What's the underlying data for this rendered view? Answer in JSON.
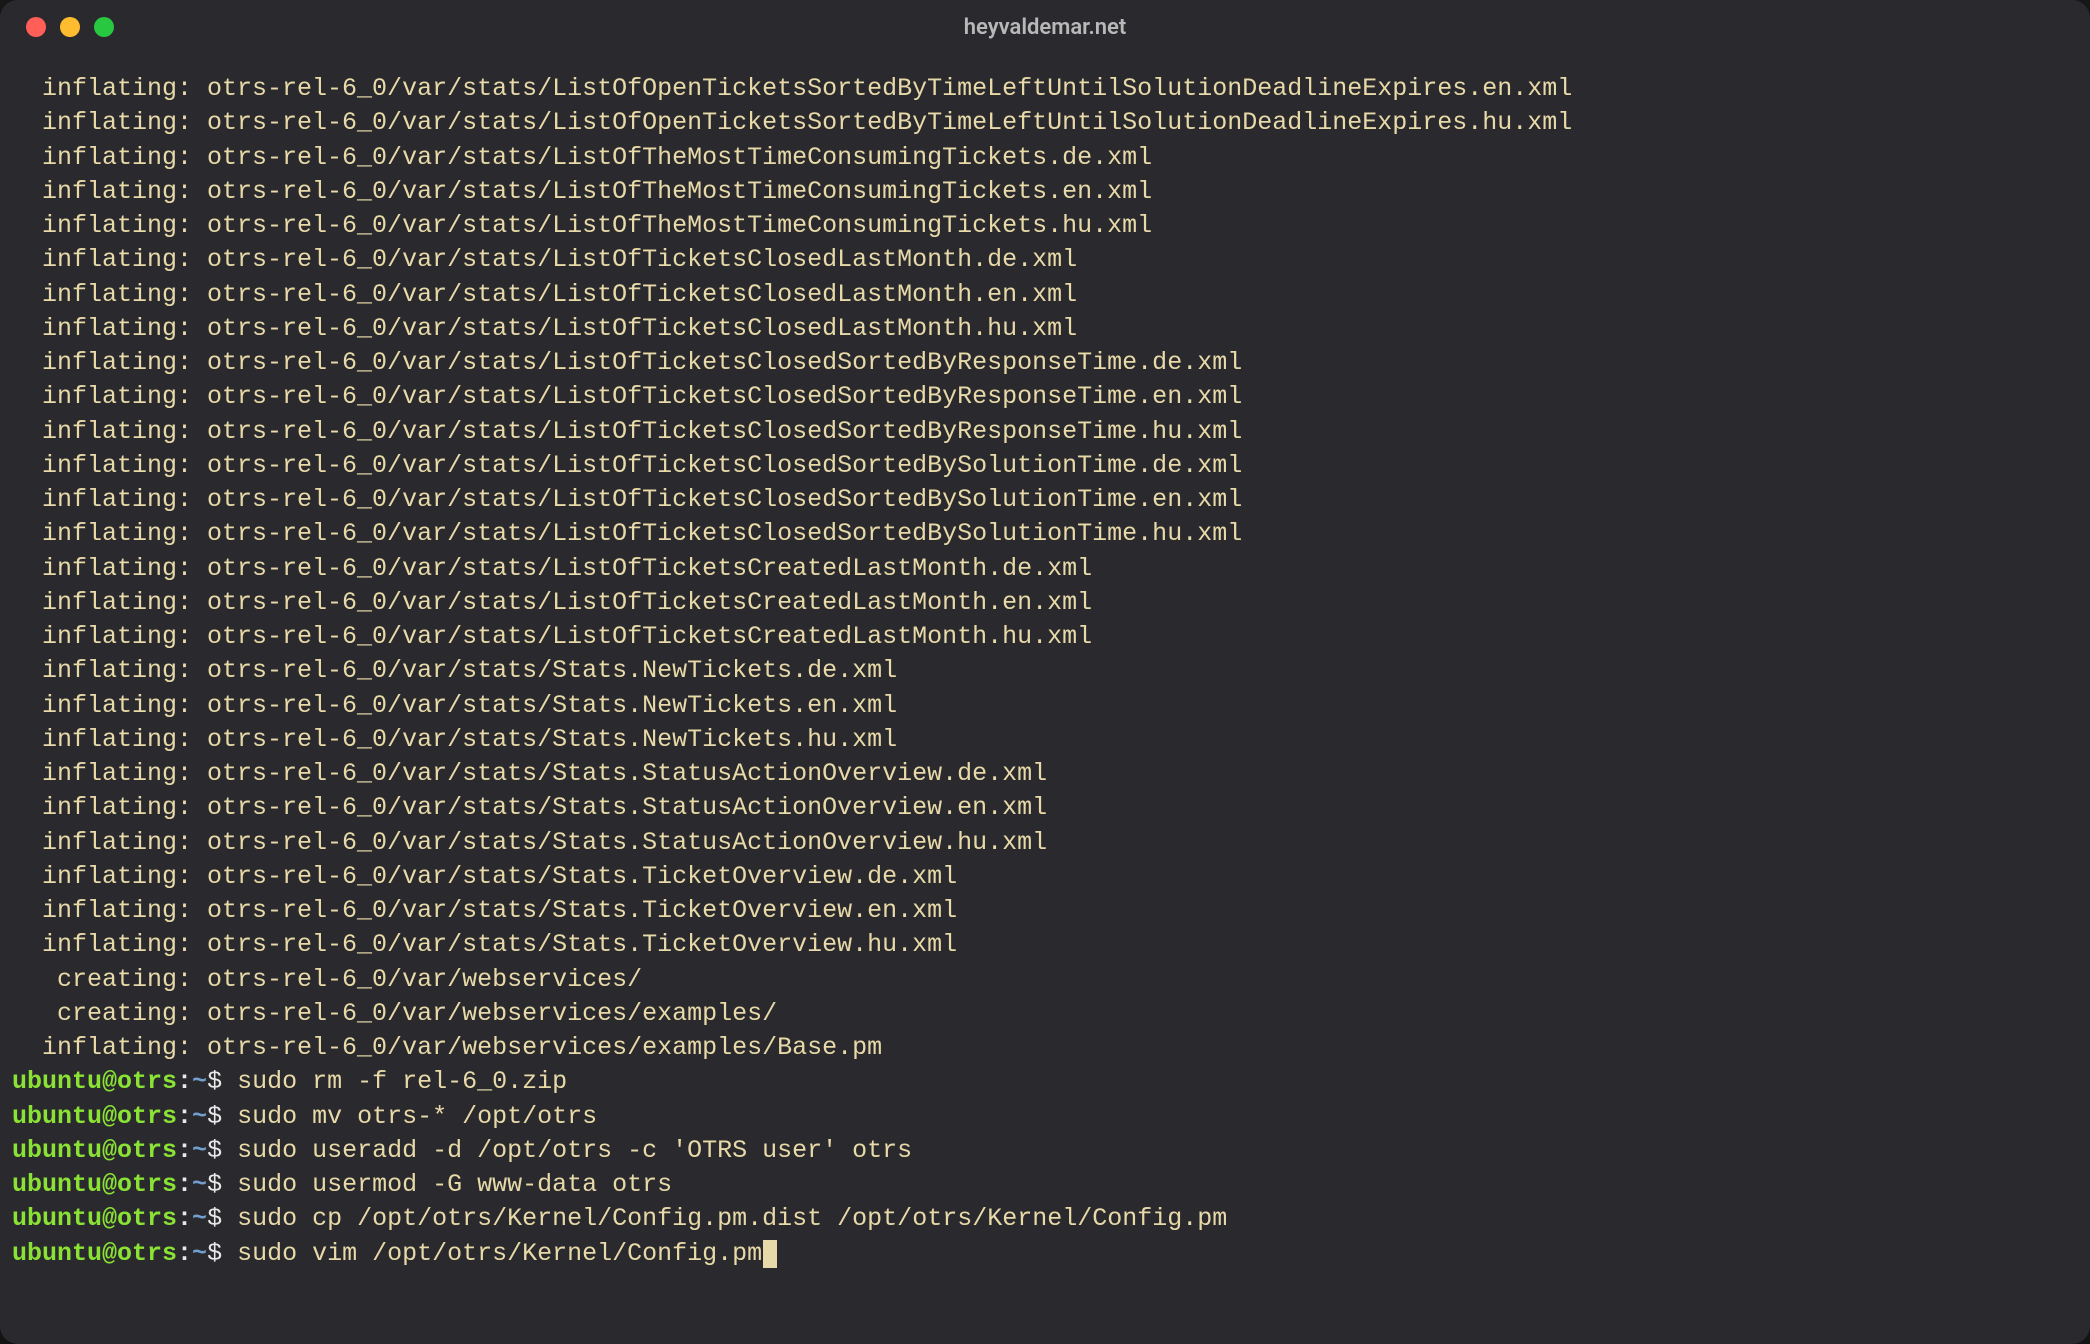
{
  "window": {
    "title": "heyvaldemar.net"
  },
  "prompt": {
    "user_host": "ubuntu@otrs",
    "path": "~",
    "symbol": "$"
  },
  "output_lines": [
    "  inflating: otrs-rel-6_0/var/stats/ListOfOpenTicketsSortedByTimeLeftUntilSolutionDeadlineExpires.en.xml  ",
    "  inflating: otrs-rel-6_0/var/stats/ListOfOpenTicketsSortedByTimeLeftUntilSolutionDeadlineExpires.hu.xml  ",
    "  inflating: otrs-rel-6_0/var/stats/ListOfTheMostTimeConsumingTickets.de.xml  ",
    "  inflating: otrs-rel-6_0/var/stats/ListOfTheMostTimeConsumingTickets.en.xml  ",
    "  inflating: otrs-rel-6_0/var/stats/ListOfTheMostTimeConsumingTickets.hu.xml  ",
    "  inflating: otrs-rel-6_0/var/stats/ListOfTicketsClosedLastMonth.de.xml  ",
    "  inflating: otrs-rel-6_0/var/stats/ListOfTicketsClosedLastMonth.en.xml  ",
    "  inflating: otrs-rel-6_0/var/stats/ListOfTicketsClosedLastMonth.hu.xml  ",
    "  inflating: otrs-rel-6_0/var/stats/ListOfTicketsClosedSortedByResponseTime.de.xml  ",
    "  inflating: otrs-rel-6_0/var/stats/ListOfTicketsClosedSortedByResponseTime.en.xml  ",
    "  inflating: otrs-rel-6_0/var/stats/ListOfTicketsClosedSortedByResponseTime.hu.xml  ",
    "  inflating: otrs-rel-6_0/var/stats/ListOfTicketsClosedSortedBySolutionTime.de.xml  ",
    "  inflating: otrs-rel-6_0/var/stats/ListOfTicketsClosedSortedBySolutionTime.en.xml  ",
    "  inflating: otrs-rel-6_0/var/stats/ListOfTicketsClosedSortedBySolutionTime.hu.xml  ",
    "  inflating: otrs-rel-6_0/var/stats/ListOfTicketsCreatedLastMonth.de.xml  ",
    "  inflating: otrs-rel-6_0/var/stats/ListOfTicketsCreatedLastMonth.en.xml  ",
    "  inflating: otrs-rel-6_0/var/stats/ListOfTicketsCreatedLastMonth.hu.xml  ",
    "  inflating: otrs-rel-6_0/var/stats/Stats.NewTickets.de.xml  ",
    "  inflating: otrs-rel-6_0/var/stats/Stats.NewTickets.en.xml  ",
    "  inflating: otrs-rel-6_0/var/stats/Stats.NewTickets.hu.xml  ",
    "  inflating: otrs-rel-6_0/var/stats/Stats.StatusActionOverview.de.xml  ",
    "  inflating: otrs-rel-6_0/var/stats/Stats.StatusActionOverview.en.xml  ",
    "  inflating: otrs-rel-6_0/var/stats/Stats.StatusActionOverview.hu.xml  ",
    "  inflating: otrs-rel-6_0/var/stats/Stats.TicketOverview.de.xml  ",
    "  inflating: otrs-rel-6_0/var/stats/Stats.TicketOverview.en.xml  ",
    "  inflating: otrs-rel-6_0/var/stats/Stats.TicketOverview.hu.xml  ",
    "   creating: otrs-rel-6_0/var/webservices/",
    "   creating: otrs-rel-6_0/var/webservices/examples/",
    "  inflating: otrs-rel-6_0/var/webservices/examples/Base.pm  "
  ],
  "commands": [
    "sudo rm -f rel-6_0.zip",
    "sudo mv otrs-* /opt/otrs",
    "sudo useradd -d /opt/otrs -c 'OTRS user' otrs",
    "sudo usermod -G www-data otrs",
    "sudo cp /opt/otrs/Kernel/Config.pm.dist /opt/otrs/Kernel/Config.pm",
    "sudo vim /opt/otrs/Kernel/Config.pm"
  ]
}
